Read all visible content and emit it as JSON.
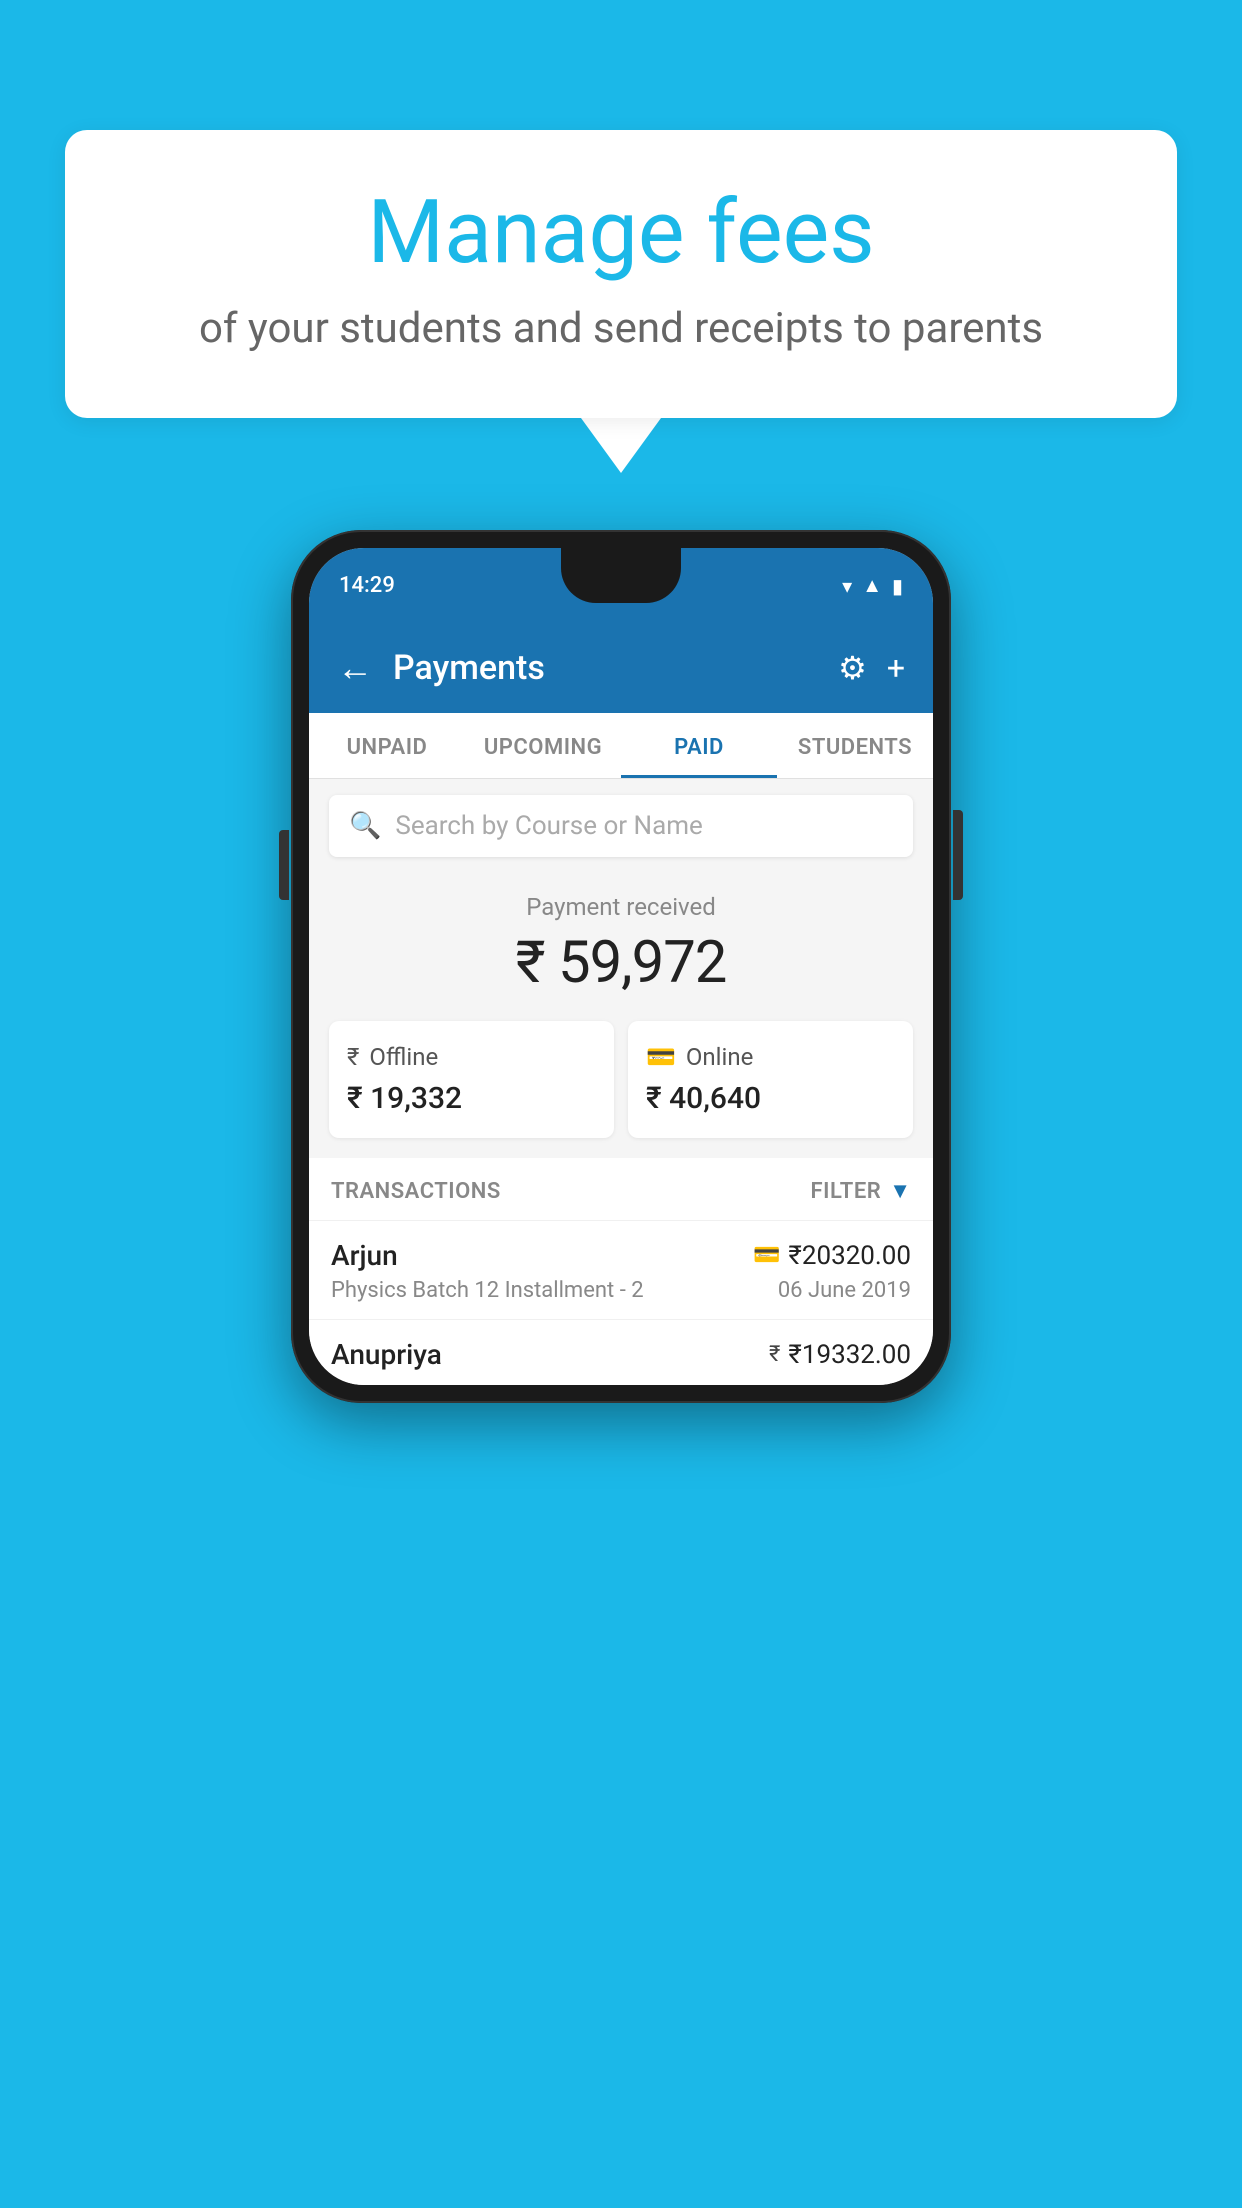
{
  "background_color": "#1bb8e8",
  "speech_bubble": {
    "title": "Manage fees",
    "subtitle": "of your students and send receipts to parents"
  },
  "phone": {
    "status_bar": {
      "time": "14:29",
      "wifi_icon": "wifi",
      "signal_icon": "signal",
      "battery_icon": "battery"
    },
    "header": {
      "back_label": "←",
      "title": "Payments",
      "gear_label": "⚙",
      "plus_label": "+"
    },
    "tabs": [
      {
        "label": "UNPAID",
        "active": false
      },
      {
        "label": "UPCOMING",
        "active": false
      },
      {
        "label": "PAID",
        "active": true
      },
      {
        "label": "STUDENTS",
        "active": false
      }
    ],
    "search": {
      "placeholder": "Search by Course or Name",
      "icon": "search"
    },
    "payment_summary": {
      "label": "Payment received",
      "amount": "₹ 59,972",
      "offline": {
        "label": "Offline",
        "amount": "₹ 19,332",
        "icon": "rupee-card"
      },
      "online": {
        "label": "Online",
        "amount": "₹ 40,640",
        "icon": "credit-card"
      }
    },
    "transactions": {
      "section_label": "TRANSACTIONS",
      "filter_label": "FILTER",
      "items": [
        {
          "name": "Arjun",
          "detail": "Physics Batch 12 Installment - 2",
          "amount": "₹20320.00",
          "date": "06 June 2019",
          "method_icon": "credit-card"
        },
        {
          "name": "Anupriya",
          "amount": "₹19332.00",
          "method_icon": "rupee-card"
        }
      ]
    }
  }
}
